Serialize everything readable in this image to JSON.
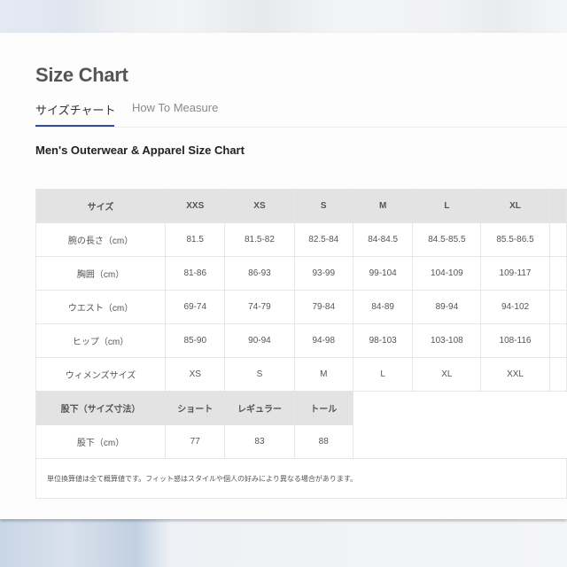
{
  "page": {
    "title": "Size Chart",
    "tabs": [
      {
        "label": "サイズチャート",
        "active": true
      },
      {
        "label": "How To Measure",
        "active": false
      }
    ],
    "subtitle": "Men's Outerwear & Apparel Size Chart",
    "accent_color": "#3a4a9a"
  },
  "size_table": {
    "header": [
      "サイズ",
      "XXS",
      "XS",
      "S",
      "M",
      "L",
      "XL"
    ],
    "rows": [
      {
        "label": "腕の長さ（cm）",
        "values": [
          "81.5",
          "81.5-82",
          "82.5-84",
          "84-84.5",
          "84.5-85.5",
          "85.5-86.5"
        ]
      },
      {
        "label": "胸囲（cm）",
        "values": [
          "81-86",
          "86-93",
          "93-99",
          "99-104",
          "104-109",
          "109-117"
        ]
      },
      {
        "label": "ウエスト（cm）",
        "values": [
          "69-74",
          "74-79",
          "79-84",
          "84-89",
          "89-94",
          "94-102"
        ]
      },
      {
        "label": "ヒップ（cm）",
        "values": [
          "85-90",
          "90-94",
          "94-98",
          "98-103",
          "103-108",
          "108-116"
        ]
      },
      {
        "label": "ウィメンズサイズ",
        "values": [
          "XS",
          "S",
          "M",
          "L",
          "XL",
          "XXL"
        ]
      }
    ]
  },
  "inseam_table": {
    "header": [
      "股下（サイズ寸法）",
      "ショート",
      "レギュラー",
      "トール"
    ],
    "rows": [
      {
        "label": "股下（cm）",
        "values": [
          "77",
          "83",
          "88"
        ]
      }
    ]
  },
  "note": "単位換算値は全て概算値です。フィット感はスタイルや個人の好みにより異なる場合があります。"
}
